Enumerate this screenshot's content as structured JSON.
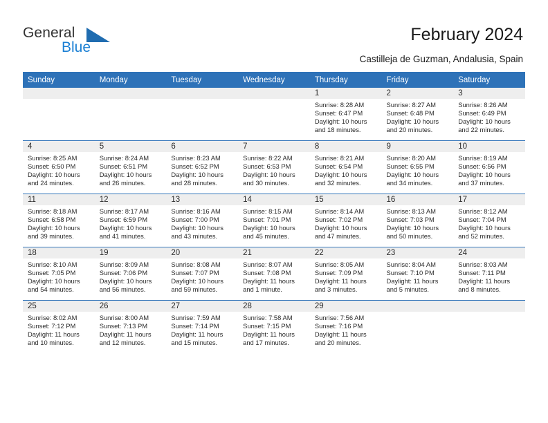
{
  "brand": {
    "name_top": "General",
    "name_bottom": "Blue",
    "color_top": "#333333",
    "color_bottom": "#1a7fd4",
    "triangle_color": "#1f6cb0"
  },
  "header": {
    "title": "February 2024",
    "subtitle": "Castilleja de Guzman, Andalusia, Spain",
    "accent_color": "#2e72b8"
  },
  "calendar": {
    "weekday_headers": [
      "Sunday",
      "Monday",
      "Tuesday",
      "Wednesday",
      "Thursday",
      "Friday",
      "Saturday"
    ],
    "weeks": [
      [
        {
          "day": "",
          "sunrise": "",
          "sunset": "",
          "daylight_line1": "",
          "daylight_line2": ""
        },
        {
          "day": "",
          "sunrise": "",
          "sunset": "",
          "daylight_line1": "",
          "daylight_line2": ""
        },
        {
          "day": "",
          "sunrise": "",
          "sunset": "",
          "daylight_line1": "",
          "daylight_line2": ""
        },
        {
          "day": "",
          "sunrise": "",
          "sunset": "",
          "daylight_line1": "",
          "daylight_line2": ""
        },
        {
          "day": "1",
          "sunrise": "Sunrise: 8:28 AM",
          "sunset": "Sunset: 6:47 PM",
          "daylight_line1": "Daylight: 10 hours",
          "daylight_line2": "and 18 minutes."
        },
        {
          "day": "2",
          "sunrise": "Sunrise: 8:27 AM",
          "sunset": "Sunset: 6:48 PM",
          "daylight_line1": "Daylight: 10 hours",
          "daylight_line2": "and 20 minutes."
        },
        {
          "day": "3",
          "sunrise": "Sunrise: 8:26 AM",
          "sunset": "Sunset: 6:49 PM",
          "daylight_line1": "Daylight: 10 hours",
          "daylight_line2": "and 22 minutes."
        }
      ],
      [
        {
          "day": "4",
          "sunrise": "Sunrise: 8:25 AM",
          "sunset": "Sunset: 6:50 PM",
          "daylight_line1": "Daylight: 10 hours",
          "daylight_line2": "and 24 minutes."
        },
        {
          "day": "5",
          "sunrise": "Sunrise: 8:24 AM",
          "sunset": "Sunset: 6:51 PM",
          "daylight_line1": "Daylight: 10 hours",
          "daylight_line2": "and 26 minutes."
        },
        {
          "day": "6",
          "sunrise": "Sunrise: 8:23 AM",
          "sunset": "Sunset: 6:52 PM",
          "daylight_line1": "Daylight: 10 hours",
          "daylight_line2": "and 28 minutes."
        },
        {
          "day": "7",
          "sunrise": "Sunrise: 8:22 AM",
          "sunset": "Sunset: 6:53 PM",
          "daylight_line1": "Daylight: 10 hours",
          "daylight_line2": "and 30 minutes."
        },
        {
          "day": "8",
          "sunrise": "Sunrise: 8:21 AM",
          "sunset": "Sunset: 6:54 PM",
          "daylight_line1": "Daylight: 10 hours",
          "daylight_line2": "and 32 minutes."
        },
        {
          "day": "9",
          "sunrise": "Sunrise: 8:20 AM",
          "sunset": "Sunset: 6:55 PM",
          "daylight_line1": "Daylight: 10 hours",
          "daylight_line2": "and 34 minutes."
        },
        {
          "day": "10",
          "sunrise": "Sunrise: 8:19 AM",
          "sunset": "Sunset: 6:56 PM",
          "daylight_line1": "Daylight: 10 hours",
          "daylight_line2": "and 37 minutes."
        }
      ],
      [
        {
          "day": "11",
          "sunrise": "Sunrise: 8:18 AM",
          "sunset": "Sunset: 6:58 PM",
          "daylight_line1": "Daylight: 10 hours",
          "daylight_line2": "and 39 minutes."
        },
        {
          "day": "12",
          "sunrise": "Sunrise: 8:17 AM",
          "sunset": "Sunset: 6:59 PM",
          "daylight_line1": "Daylight: 10 hours",
          "daylight_line2": "and 41 minutes."
        },
        {
          "day": "13",
          "sunrise": "Sunrise: 8:16 AM",
          "sunset": "Sunset: 7:00 PM",
          "daylight_line1": "Daylight: 10 hours",
          "daylight_line2": "and 43 minutes."
        },
        {
          "day": "14",
          "sunrise": "Sunrise: 8:15 AM",
          "sunset": "Sunset: 7:01 PM",
          "daylight_line1": "Daylight: 10 hours",
          "daylight_line2": "and 45 minutes."
        },
        {
          "day": "15",
          "sunrise": "Sunrise: 8:14 AM",
          "sunset": "Sunset: 7:02 PM",
          "daylight_line1": "Daylight: 10 hours",
          "daylight_line2": "and 47 minutes."
        },
        {
          "day": "16",
          "sunrise": "Sunrise: 8:13 AM",
          "sunset": "Sunset: 7:03 PM",
          "daylight_line1": "Daylight: 10 hours",
          "daylight_line2": "and 50 minutes."
        },
        {
          "day": "17",
          "sunrise": "Sunrise: 8:12 AM",
          "sunset": "Sunset: 7:04 PM",
          "daylight_line1": "Daylight: 10 hours",
          "daylight_line2": "and 52 minutes."
        }
      ],
      [
        {
          "day": "18",
          "sunrise": "Sunrise: 8:10 AM",
          "sunset": "Sunset: 7:05 PM",
          "daylight_line1": "Daylight: 10 hours",
          "daylight_line2": "and 54 minutes."
        },
        {
          "day": "19",
          "sunrise": "Sunrise: 8:09 AM",
          "sunset": "Sunset: 7:06 PM",
          "daylight_line1": "Daylight: 10 hours",
          "daylight_line2": "and 56 minutes."
        },
        {
          "day": "20",
          "sunrise": "Sunrise: 8:08 AM",
          "sunset": "Sunset: 7:07 PM",
          "daylight_line1": "Daylight: 10 hours",
          "daylight_line2": "and 59 minutes."
        },
        {
          "day": "21",
          "sunrise": "Sunrise: 8:07 AM",
          "sunset": "Sunset: 7:08 PM",
          "daylight_line1": "Daylight: 11 hours",
          "daylight_line2": "and 1 minute."
        },
        {
          "day": "22",
          "sunrise": "Sunrise: 8:05 AM",
          "sunset": "Sunset: 7:09 PM",
          "daylight_line1": "Daylight: 11 hours",
          "daylight_line2": "and 3 minutes."
        },
        {
          "day": "23",
          "sunrise": "Sunrise: 8:04 AM",
          "sunset": "Sunset: 7:10 PM",
          "daylight_line1": "Daylight: 11 hours",
          "daylight_line2": "and 5 minutes."
        },
        {
          "day": "24",
          "sunrise": "Sunrise: 8:03 AM",
          "sunset": "Sunset: 7:11 PM",
          "daylight_line1": "Daylight: 11 hours",
          "daylight_line2": "and 8 minutes."
        }
      ],
      [
        {
          "day": "25",
          "sunrise": "Sunrise: 8:02 AM",
          "sunset": "Sunset: 7:12 PM",
          "daylight_line1": "Daylight: 11 hours",
          "daylight_line2": "and 10 minutes."
        },
        {
          "day": "26",
          "sunrise": "Sunrise: 8:00 AM",
          "sunset": "Sunset: 7:13 PM",
          "daylight_line1": "Daylight: 11 hours",
          "daylight_line2": "and 12 minutes."
        },
        {
          "day": "27",
          "sunrise": "Sunrise: 7:59 AM",
          "sunset": "Sunset: 7:14 PM",
          "daylight_line1": "Daylight: 11 hours",
          "daylight_line2": "and 15 minutes."
        },
        {
          "day": "28",
          "sunrise": "Sunrise: 7:58 AM",
          "sunset": "Sunset: 7:15 PM",
          "daylight_line1": "Daylight: 11 hours",
          "daylight_line2": "and 17 minutes."
        },
        {
          "day": "29",
          "sunrise": "Sunrise: 7:56 AM",
          "sunset": "Sunset: 7:16 PM",
          "daylight_line1": "Daylight: 11 hours",
          "daylight_line2": "and 20 minutes."
        },
        {
          "day": "",
          "sunrise": "",
          "sunset": "",
          "daylight_line1": "",
          "daylight_line2": ""
        },
        {
          "day": "",
          "sunrise": "",
          "sunset": "",
          "daylight_line1": "",
          "daylight_line2": ""
        }
      ]
    ]
  }
}
